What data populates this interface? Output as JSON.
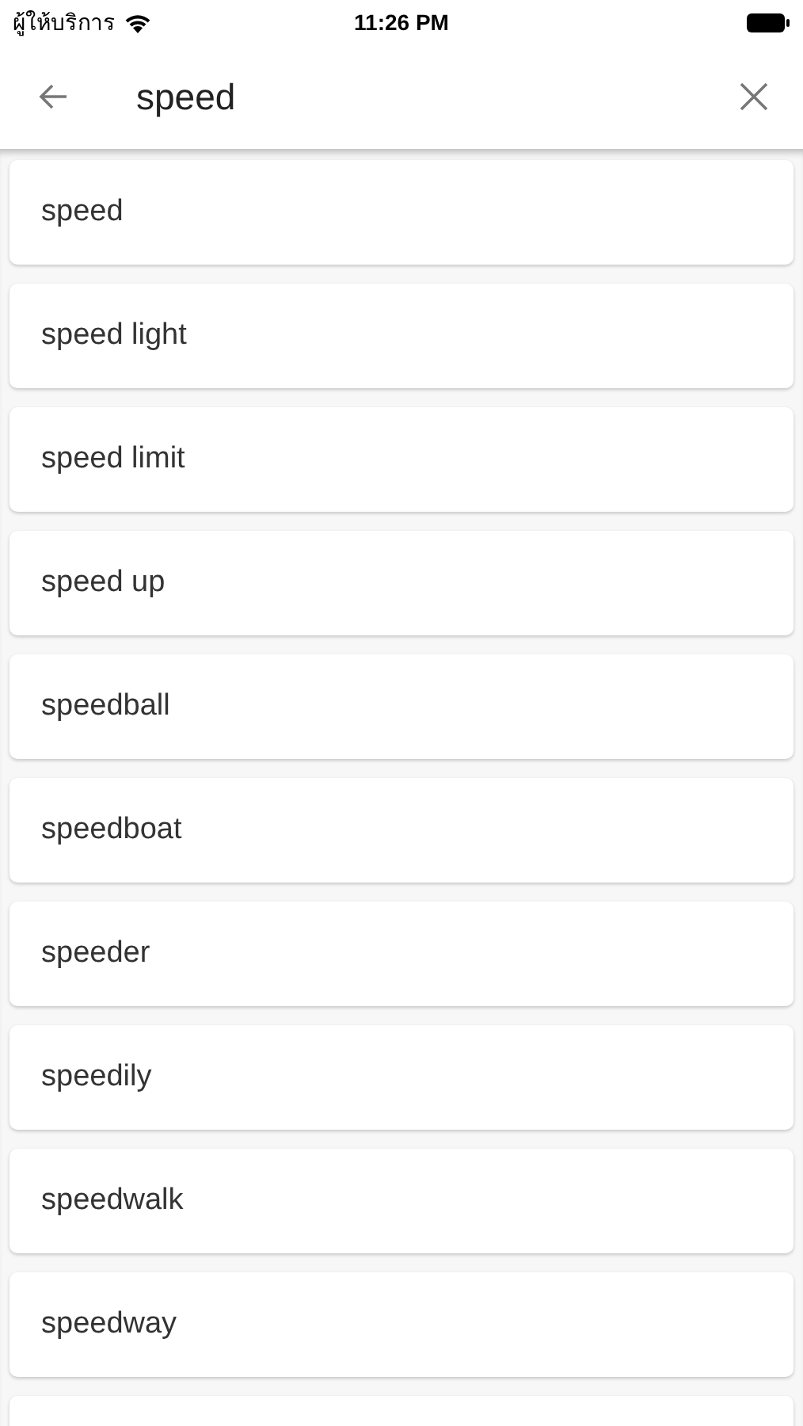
{
  "status_bar": {
    "carrier": "ผู้ให้บริการ",
    "time": "11:26 PM"
  },
  "search": {
    "value": "speed"
  },
  "suggestions": [
    {
      "text": "speed"
    },
    {
      "text": "speed light"
    },
    {
      "text": "speed limit"
    },
    {
      "text": "speed up"
    },
    {
      "text": "speedball"
    },
    {
      "text": "speedboat"
    },
    {
      "text": "speeder"
    },
    {
      "text": "speedily"
    },
    {
      "text": "speedwalk"
    },
    {
      "text": "speedway"
    }
  ]
}
